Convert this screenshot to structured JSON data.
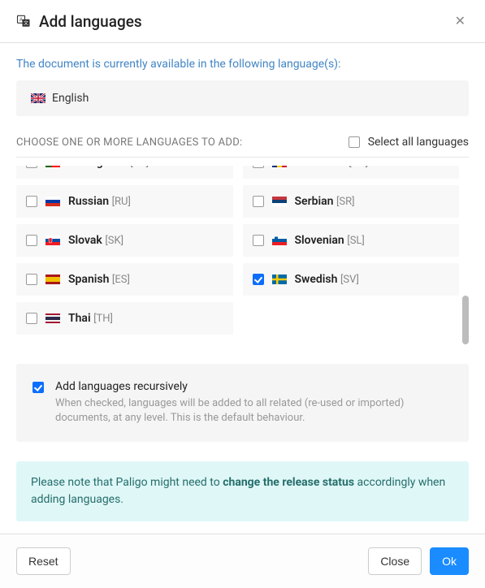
{
  "header": {
    "title": "Add languages"
  },
  "intro": "The document is currently available in the following language(s):",
  "current_language": {
    "name": "English",
    "flag": "gb"
  },
  "choose_label": "CHOOSE ONE OR MORE LANGUAGES TO ADD:",
  "select_all_label": "Select all languages",
  "select_all_checked": false,
  "languages": [
    {
      "name": "Portuguese",
      "code": "PT",
      "flag": "pt",
      "checked": false
    },
    {
      "name": "Romanian",
      "code": "RO",
      "flag": "ro",
      "checked": false
    },
    {
      "name": "Russian",
      "code": "RU",
      "flag": "ru",
      "checked": false
    },
    {
      "name": "Serbian",
      "code": "SR",
      "flag": "rs",
      "checked": false
    },
    {
      "name": "Slovak",
      "code": "SK",
      "flag": "sk",
      "checked": false
    },
    {
      "name": "Slovenian",
      "code": "SL",
      "flag": "si",
      "checked": false
    },
    {
      "name": "Spanish",
      "code": "ES",
      "flag": "es",
      "checked": false
    },
    {
      "name": "Swedish",
      "code": "SV",
      "flag": "se",
      "checked": true
    },
    {
      "name": "Thai",
      "code": "TH",
      "flag": "th",
      "checked": false
    }
  ],
  "recursive": {
    "checked": true,
    "title": "Add languages recursively",
    "desc": "When checked, languages will be added to all related (re-used or imported) documents, at any level. This is the default behaviour."
  },
  "note_prefix": "Please note that Paligo might need to ",
  "note_bold": "change the release status",
  "note_suffix": " accordingly when adding languages.",
  "footer": {
    "reset_label": "Reset",
    "close_label": "Close",
    "ok_label": "Ok"
  }
}
